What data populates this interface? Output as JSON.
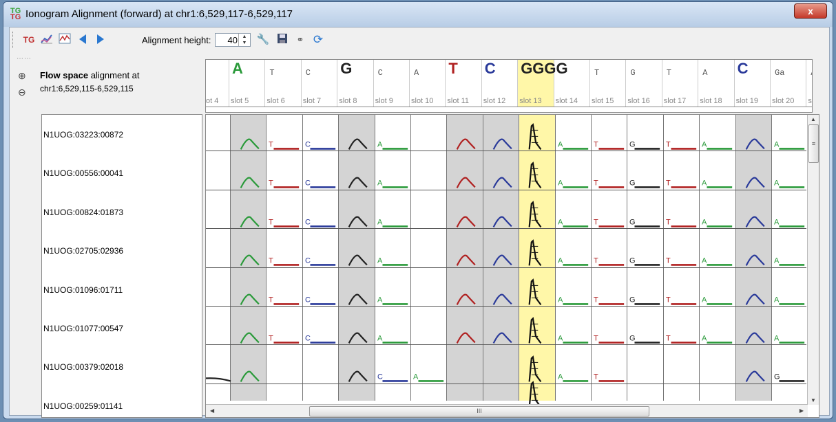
{
  "window": {
    "title": "Ionogram Alignment (forward) at chr1:6,529,117-6,529,117",
    "close_label": "x"
  },
  "toolbar": {
    "alignment_height_label": "Alignment height:",
    "alignment_height_value": "40"
  },
  "info": {
    "title_bold": "Flow space",
    "title_rest": " alignment at",
    "coords": "chr1:6,529,115-6,529,115"
  },
  "header_slots": [
    {
      "label": "ot 4",
      "base": "",
      "color": "#000",
      "size": "small",
      "gray": false
    },
    {
      "label": "slot 5",
      "base": "A",
      "color": "#2a9a3a",
      "size": "big",
      "gray": true
    },
    {
      "label": "slot 6",
      "base": "T",
      "color": "#555",
      "size": "small",
      "gray": false
    },
    {
      "label": "slot 7",
      "base": "C",
      "color": "#555",
      "size": "small",
      "gray": false
    },
    {
      "label": "slot 8",
      "base": "G",
      "color": "#222",
      "size": "big",
      "gray": true
    },
    {
      "label": "slot 9",
      "base": "C",
      "color": "#555",
      "size": "small",
      "gray": false
    },
    {
      "label": "slot 10",
      "base": "A",
      "color": "#555",
      "size": "small",
      "gray": false
    },
    {
      "label": "slot 11",
      "base": "T",
      "color": "#b02020",
      "size": "big",
      "gray": true
    },
    {
      "label": "slot 12",
      "base": "C",
      "color": "#2a3a9a",
      "size": "big",
      "gray": true
    },
    {
      "label": "slot 13",
      "base": "GGGG",
      "color": "#222",
      "size": "big",
      "gray": false,
      "highlight": true
    },
    {
      "label": "slot 14",
      "base": "",
      "color": "#555",
      "size": "small",
      "gray": false
    },
    {
      "label": "slot 15",
      "base": "T",
      "color": "#555",
      "size": "small",
      "gray": false
    },
    {
      "label": "slot 16",
      "base": "G",
      "color": "#555",
      "size": "small",
      "gray": false
    },
    {
      "label": "slot 17",
      "base": "T",
      "color": "#555",
      "size": "small",
      "gray": false
    },
    {
      "label": "slot 18",
      "base": "A",
      "color": "#555",
      "size": "small",
      "gray": false
    },
    {
      "label": "slot 19",
      "base": "C",
      "color": "#2a3a9a",
      "size": "big",
      "gray": true
    },
    {
      "label": "slot 20",
      "base": "Ga",
      "color": "#555",
      "size": "small",
      "gray": false
    },
    {
      "label": "sl",
      "base": "A",
      "color": "#555",
      "size": "small",
      "gray": false
    }
  ],
  "reads": [
    "N1UOG:03223:00872",
    "N1UOG:00556:00041",
    "N1UOG:00824:01873",
    "N1UOG:02705:02936",
    "N1UOG:01096:01711",
    "N1UOG:01077:00547",
    "N1UOG:00379:02018",
    "N1UOG:00259:01141"
  ],
  "cells": {
    "row_template": [
      {
        "type": "empty"
      },
      {
        "type": "hump",
        "color": "#2a9a3a"
      },
      {
        "type": "flat",
        "letter": "T",
        "color": "#b02020"
      },
      {
        "type": "flat",
        "letter": "C",
        "color": "#2a3a9a"
      },
      {
        "type": "hump",
        "color": "#222222"
      },
      {
        "type": "flat",
        "letter": "A",
        "color": "#2a9a3a"
      },
      {
        "type": "empty"
      },
      {
        "type": "hump",
        "color": "#b02020"
      },
      {
        "type": "hump",
        "color": "#2a3a9a"
      },
      {
        "type": "peak",
        "color": "#111111"
      },
      {
        "type": "flat",
        "letter": "A",
        "color": "#2a9a3a"
      },
      {
        "type": "flat",
        "letter": "T",
        "color": "#b02020"
      },
      {
        "type": "flat",
        "letter": "G",
        "color": "#222222"
      },
      {
        "type": "flat",
        "letter": "T",
        "color": "#b02020"
      },
      {
        "type": "flat",
        "letter": "A",
        "color": "#2a9a3a"
      },
      {
        "type": "hump",
        "color": "#2a3a9a"
      },
      {
        "type": "flat",
        "letter": "A",
        "color": "#2a9a3a"
      }
    ],
    "row7": [
      {
        "type": "tail",
        "color": "#222222"
      },
      {
        "type": "hump",
        "color": "#2a9a3a"
      },
      {
        "type": "empty"
      },
      {
        "type": "empty"
      },
      {
        "type": "hump",
        "color": "#222222"
      },
      {
        "type": "flat",
        "letter": "C",
        "color": "#2a3a9a"
      },
      {
        "type": "flat",
        "letter": "A",
        "color": "#2a9a3a"
      },
      {
        "type": "empty"
      },
      {
        "type": "empty"
      },
      {
        "type": "peak",
        "color": "#111111"
      },
      {
        "type": "flat",
        "letter": "A",
        "color": "#2a9a3a"
      },
      {
        "type": "flat",
        "letter": "T",
        "color": "#b02020"
      },
      {
        "type": "empty"
      },
      {
        "type": "empty"
      },
      {
        "type": "empty"
      },
      {
        "type": "hump",
        "color": "#2a3a9a"
      },
      {
        "type": "flat",
        "letter": "G",
        "color": "#222222"
      }
    ]
  },
  "scroll": {
    "h_thumb_glyph": "III",
    "v_thumb_glyph": "≡"
  },
  "colors": {
    "gray_col": "#d4d4d4",
    "highlight_col": "#fff7a8"
  }
}
